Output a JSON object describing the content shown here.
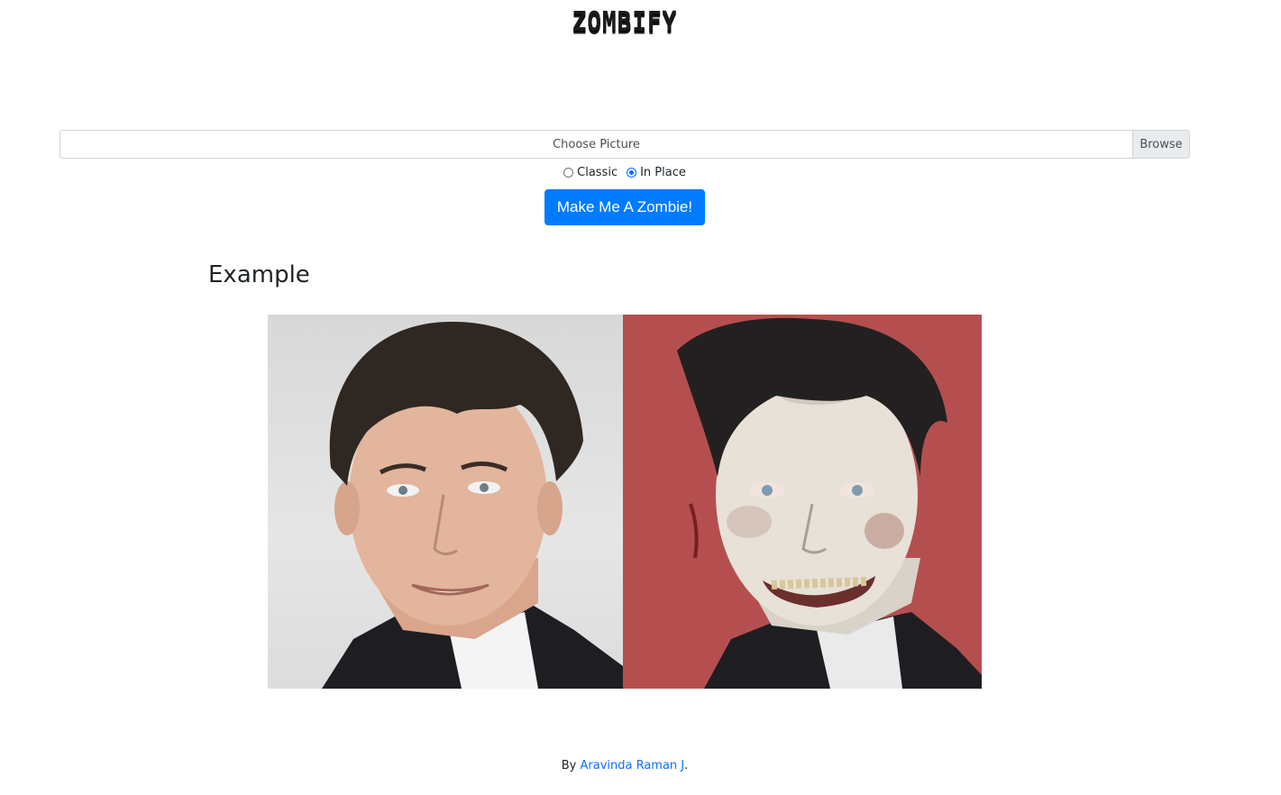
{
  "header": {
    "title": "ZOMBIFY"
  },
  "upload": {
    "label": "Choose Picture",
    "browse_label": "Browse"
  },
  "mode": {
    "options": [
      {
        "label": "Classic",
        "selected": false
      },
      {
        "label": "In Place",
        "selected": true
      }
    ]
  },
  "actions": {
    "zombify_label": "Make Me A Zombie!"
  },
  "example": {
    "heading": "Example",
    "before_image": "portrait-photo",
    "after_image": "zombified-portrait"
  },
  "footer": {
    "prefix": "By",
    "author": "Aravinda Raman J",
    "suffix": "."
  },
  "colors": {
    "primary": "#007bff",
    "link": "#0d6efd",
    "zombie_background": "#b54f4f"
  }
}
